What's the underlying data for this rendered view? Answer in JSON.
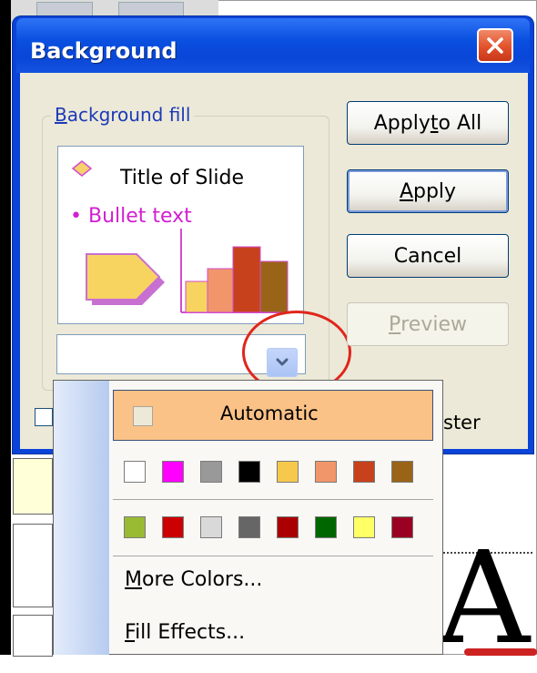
{
  "dialog": {
    "title": "Background",
    "group_label_pre": "",
    "group_label_key": "B",
    "group_label_post": "ackground fill",
    "preview": {
      "title_text": "Title of Slide",
      "bullet_text": "• Bullet text"
    },
    "buttons": {
      "apply_all_pre": "Apply ",
      "apply_all_key": "t",
      "apply_all_post": "o All",
      "apply_key": "A",
      "apply_post": "pply",
      "cancel": "Cancel",
      "preview_key": "P",
      "preview_post": "review"
    },
    "omit_master_visible": "ster"
  },
  "menu": {
    "automatic": "Automatic",
    "more_colors_key": "M",
    "more_colors_post": "ore Colors...",
    "fill_effects_key": "F",
    "fill_effects_post": "ill Effects...",
    "swatch_row1": [
      "#ffffff",
      "#ff00ff",
      "#999999",
      "#000000",
      "#f6c84c",
      "#f1956a",
      "#c7411c",
      "#9a6418"
    ],
    "swatch_row2": [
      "#99bb33",
      "#cc0000",
      "#d9d9d9",
      "#666666",
      "#aa0000",
      "#006600",
      "#ffff66",
      "#990022"
    ]
  },
  "colors": {
    "title_bar": "#0a50e0",
    "dialog_face": "#ece9d8",
    "menu_highlight": "#fbc287",
    "annotation_circle": "#e0261c",
    "bullet_text": "#d21fd2"
  }
}
